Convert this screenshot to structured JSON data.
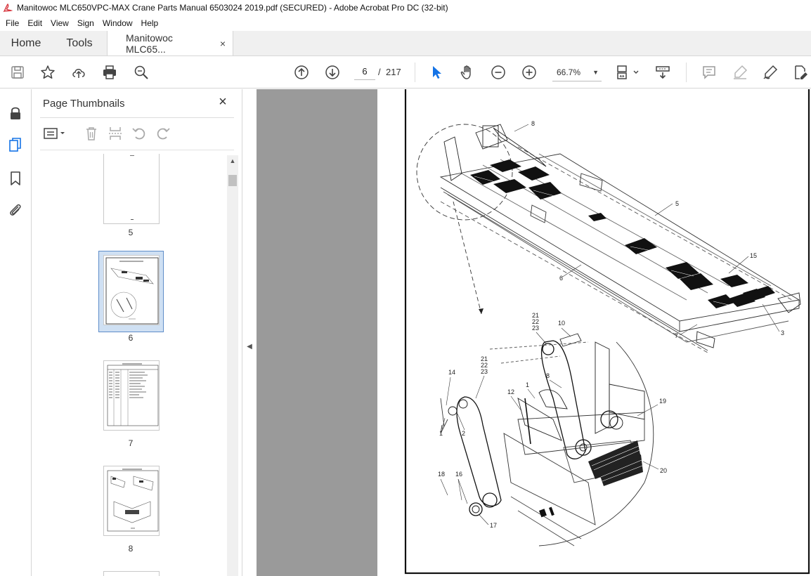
{
  "window": {
    "title": "Manitowoc MLC650VPC-MAX Crane Parts Manual 6503024 2019.pdf (SECURED) - Adobe Acrobat Pro DC (32-bit)"
  },
  "menu": [
    "File",
    "Edit",
    "View",
    "Sign",
    "Window",
    "Help"
  ],
  "tabs": {
    "home": "Home",
    "tools": "Tools",
    "document": "Manitowoc MLC65...",
    "close_symbol": "×"
  },
  "toolbar": {
    "icons": [
      "save-icon",
      "star-icon",
      "upload-icon",
      "print-icon",
      "search-zoom-icon",
      "page-up-icon",
      "page-down-icon",
      "select-cursor-icon",
      "hand-icon",
      "zoom-out-icon",
      "zoom-in-icon",
      "fit-page-icon",
      "scroll-mode-icon",
      "comment-icon",
      "highlight-icon",
      "sign-icon",
      "edit-pdf-icon"
    ],
    "current_page": "6",
    "page_separator": "/",
    "total_pages": "217",
    "zoom": "66.7%"
  },
  "left_rail": {
    "icons": [
      "lock-icon",
      "page-thumbnails-icon",
      "bookmark-icon",
      "attachment-icon"
    ]
  },
  "thumbnails_panel": {
    "title": "Page Thumbnails",
    "close_symbol": "×",
    "tool_icons": [
      "options-menu-icon",
      "delete-icon",
      "extract-icon",
      "rotate-left-icon",
      "rotate-right-icon"
    ],
    "pages": [
      {
        "label": "5",
        "selected": false
      },
      {
        "label": "6",
        "selected": true
      },
      {
        "label": "7",
        "selected": false
      },
      {
        "label": "8",
        "selected": false
      }
    ]
  },
  "document": {
    "callouts": [
      "8",
      "5",
      "15",
      "6",
      "3",
      "7",
      "21",
      "22",
      "23",
      "10",
      "21",
      "22",
      "23",
      "14",
      "8",
      "12",
      "1",
      "19",
      "1",
      "2",
      "20",
      "18",
      "16",
      "17"
    ]
  },
  "colors": {
    "accent": "#1473e6",
    "acrobat_red": "#d7373f",
    "doc_background": "#9a9a9a",
    "thumb_selected": "#cfe0f3"
  }
}
